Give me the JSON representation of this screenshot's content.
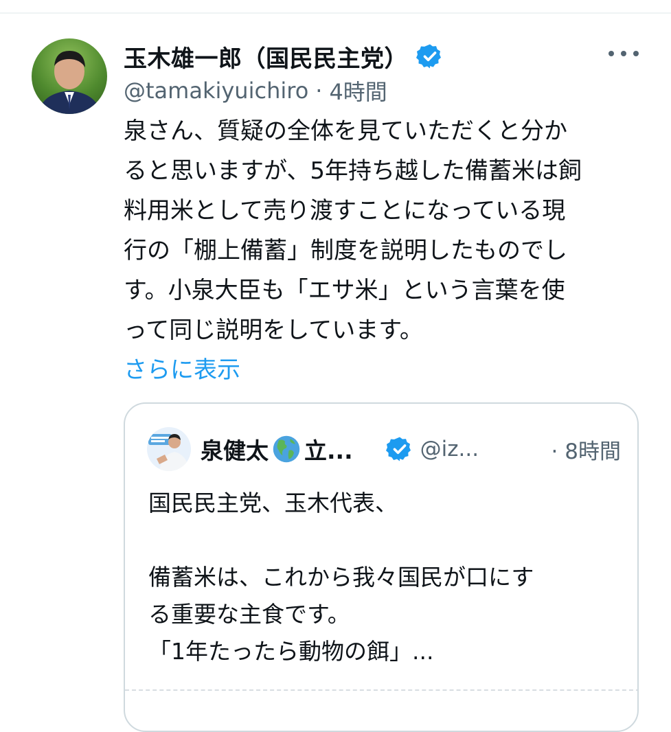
{
  "tweet": {
    "display_name": "玉木雄一郎（国民民主党）",
    "handle": "@tamakiyuichiro",
    "separator": "·",
    "time": "4時間",
    "text": "泉さん、質疑の全体を見ていただくと分か\nると思いますが、5年持ち越した備蓄米は飼\n料用米として売り渡すことになっている現\n行の「棚上備蓄」制度を説明したものでし\nす。小泉大臣も「エサ米」という言葉を使\nって同じ説明をしています。",
    "show_more": "さらに表示",
    "accent_color": "#1d9bf0"
  },
  "quoted_tweet": {
    "display_name": "泉健太",
    "name_tail": "立...",
    "handle": "@iz...",
    "separator": "·",
    "time": "8時間",
    "text": "国民民主党、玉木代表、\n\n備蓄米は、これから我々国民が口にす\nる重要な主食です。\n「1年たったら動物の餌」..."
  },
  "icons": {
    "verified": "verified-badge-icon",
    "more": "more-options-icon",
    "globe": "globe-americas-icon"
  }
}
